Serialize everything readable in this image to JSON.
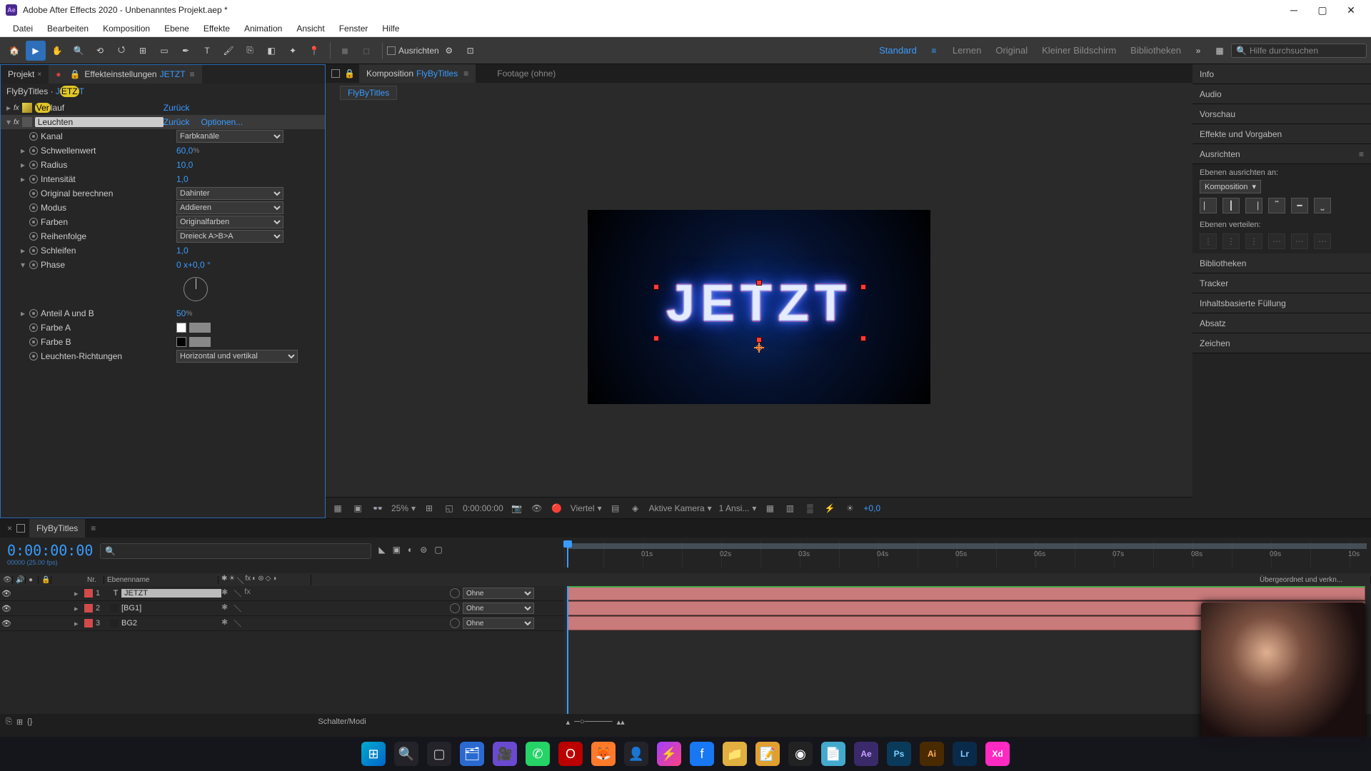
{
  "app": {
    "title": "Adobe After Effects 2020 - Unbenanntes Projekt.aep *",
    "logo_text": "Ae"
  },
  "menu": [
    "Datei",
    "Bearbeiten",
    "Komposition",
    "Ebene",
    "Effekte",
    "Animation",
    "Ansicht",
    "Fenster",
    "Hilfe"
  ],
  "toolbar": {
    "snap_label": "Ausrichten",
    "workspaces": {
      "standard": "Standard",
      "lernen": "Lernen",
      "original": "Original",
      "kleiner": "Kleiner Bildschirm",
      "bibliotheken": "Bibliotheken"
    },
    "search_placeholder": "Hilfe durchsuchen"
  },
  "left_panel": {
    "tab_projekt": "Projekt",
    "tab_fx_label": "Effekteinstellungen",
    "tab_fx_layer": "JETZT",
    "breadcrumb_comp": "FlyByTitles",
    "breadcrumb_layer": "JETZT",
    "effects": [
      {
        "name": "Verlauf",
        "reset": "Zurück",
        "options": ""
      },
      {
        "name": "Leuchten",
        "selected": true,
        "reset": "Zurück",
        "options": "Optionen..."
      }
    ],
    "props": {
      "kanal": {
        "label": "Kanal",
        "value": "Farbkanäle",
        "type": "dd"
      },
      "schwellenwert": {
        "label": "Schwellenwert",
        "value": "60,0",
        "suffix": "%"
      },
      "radius": {
        "label": "Radius",
        "value": "10,0"
      },
      "intensitaet": {
        "label": "Intensität",
        "value": "1,0"
      },
      "original": {
        "label": "Original berechnen",
        "value": "Dahinter",
        "type": "dd"
      },
      "modus": {
        "label": "Modus",
        "value": "Addieren",
        "type": "dd"
      },
      "farben": {
        "label": "Farben",
        "value": "Originalfarben",
        "type": "dd"
      },
      "reihenfolge": {
        "label": "Reihenfolge",
        "value": "Dreieck A>B>A",
        "type": "dd"
      },
      "schleifen": {
        "label": "Schleifen",
        "value": "1,0"
      },
      "phase": {
        "label": "Phase",
        "value": "0 x+0,0 °"
      },
      "anteil": {
        "label": "Anteil A und B",
        "value": "50",
        "suffix": "%"
      },
      "farbe_a": {
        "label": "Farbe A"
      },
      "farbe_b": {
        "label": "Farbe B"
      },
      "richtungen": {
        "label": "Leuchten-Richtungen",
        "value": "Horizontal und vertikal",
        "type": "dd"
      }
    }
  },
  "center": {
    "tab_komposition": "Komposition",
    "tab_komposition_name": "FlyByTitles",
    "tab_footage": "Footage  (ohne)",
    "subtab": "FlyByTitles",
    "title_text": "JETZT",
    "footer": {
      "zoom": "25%",
      "timecode": "0:00:00:00",
      "resolution": "Viertel",
      "camera": "Aktive Kamera",
      "views": "1 Ansi...",
      "exposure": "+0,0"
    }
  },
  "right": {
    "info": "Info",
    "audio": "Audio",
    "vorschau": "Vorschau",
    "vorgaben": "Effekte und Vorgaben",
    "ausrichten": {
      "title": "Ausrichten",
      "label_to": "Ebenen ausrichten an:",
      "target": "Komposition",
      "distribute": "Ebenen verteilen:"
    },
    "bibliotheken": "Bibliotheken",
    "tracker": "Tracker",
    "inhalt": "Inhaltsbasierte Füllung",
    "absatz": "Absatz",
    "zeichen": "Zeichen"
  },
  "timeline": {
    "tab_name": "FlyByTitles",
    "timecode": "0:00:00:00",
    "frame_sub": "00000 (25.00 fps)",
    "cols": {
      "nr": "Nr.",
      "ebenenname": "Ebenenname",
      "parent": "Übergeordnet und verkn..."
    },
    "ticks": [
      "01s",
      "02s",
      "03s",
      "04s",
      "05s",
      "06s",
      "07s",
      "08s",
      "09s",
      "10s"
    ],
    "parent_none": "Ohne",
    "layers": [
      {
        "num": "1",
        "name": "JETZT",
        "color": "#d24a4a",
        "type": "T",
        "fx": true,
        "selected": true
      },
      {
        "num": "2",
        "name": "[BG1]",
        "color": "#d24a4a",
        "type": "solid"
      },
      {
        "num": "3",
        "name": "BG2",
        "color": "#d24a4a",
        "type": "solid"
      }
    ],
    "footer_mode": "Schalter/Modi"
  },
  "taskbar": {
    "items": [
      "win",
      "search",
      "tasks",
      "explorer",
      "video",
      "whatsapp",
      "opera",
      "firefox",
      "person",
      "messenger",
      "facebook",
      "folder",
      "notes",
      "obs",
      "notepad",
      "ae",
      "ps",
      "ai",
      "lr",
      "xd"
    ]
  }
}
